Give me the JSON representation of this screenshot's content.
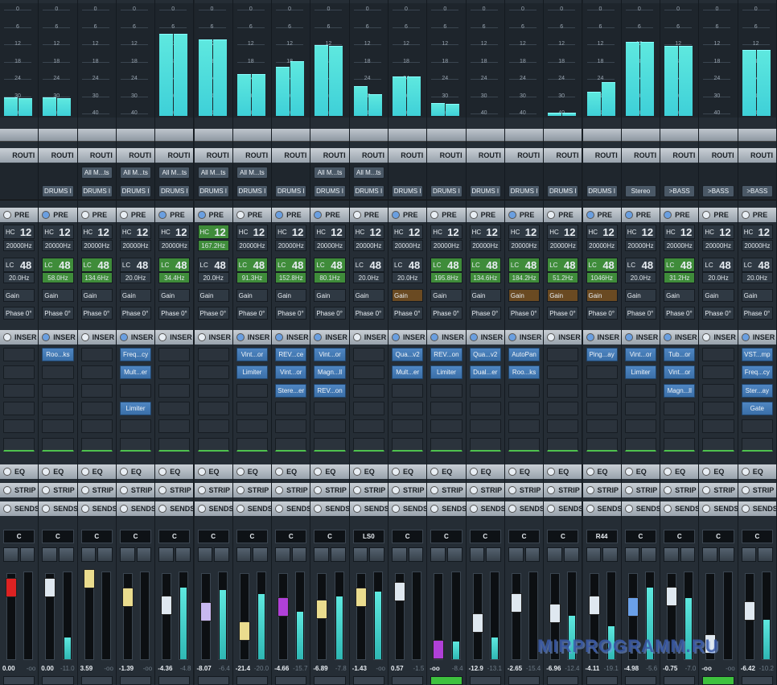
{
  "meter_scale": [
    "0",
    "6",
    "12",
    "18",
    "24",
    "30",
    "40"
  ],
  "section_labels": {
    "routing": "ROUTI",
    "pre": "PRE",
    "inserts": "INSER",
    "eq": "EQ",
    "strip": "STRIP",
    "sends": "SENDS"
  },
  "watermark": "MIRPROGRAMM.RU",
  "channels": [
    {
      "meter": [
        0.17,
        0.16
      ],
      "route_top": "",
      "route_bottom": "",
      "pre_on": false,
      "hc_freq": "20000Hz",
      "hc_hi": false,
      "lc_freq": "20.0Hz",
      "lc_hi": false,
      "gain_org": false,
      "inserts": [
        "",
        "",
        "",
        "",
        "",
        ""
      ],
      "pan": "C",
      "fader": 0.85,
      "fader_color": "#d22",
      "vu": 0,
      "val": "0.00",
      "peak": "-oo",
      "bottom_green": false
    },
    {
      "meter": [
        0.17,
        0.16
      ],
      "route_top": "",
      "route_bottom": "DRUMS I",
      "pre_on": true,
      "hc_freq": "20000Hz",
      "hc_hi": false,
      "lc_freq": "58.0Hz",
      "lc_hi": true,
      "gain_org": false,
      "inserts": [
        "Roo...ks",
        "",
        "",
        "",
        "",
        ""
      ],
      "pan": "C",
      "fader": 0.85,
      "fader_color": "#dfe8f0",
      "vu": 0.25,
      "val": "0.00",
      "peak": "-11.0",
      "bottom_green": false
    },
    {
      "meter": [
        0,
        0
      ],
      "route_top": "All M...ts",
      "route_bottom": "DRUMS I",
      "pre_on": false,
      "hc_freq": "20000Hz",
      "hc_hi": false,
      "lc_freq": "134.6Hz",
      "lc_hi": true,
      "gain_org": false,
      "inserts": [
        "",
        "",
        "",
        "",
        "",
        ""
      ],
      "pan": "C",
      "fader": 0.97,
      "fader_color": "#eadc8e",
      "vu": 0,
      "val": "3.59",
      "peak": "-oo",
      "bottom_green": false
    },
    {
      "meter": [
        0,
        0
      ],
      "route_top": "All M...ts",
      "route_bottom": "DRUMS I",
      "pre_on": false,
      "hc_freq": "20000Hz",
      "hc_hi": false,
      "lc_freq": "20.0Hz",
      "lc_hi": false,
      "gain_org": false,
      "inserts": [
        "Freq...cy",
        "Mult...er",
        "",
        "Limiter",
        "",
        ""
      ],
      "pan": "C",
      "fader": 0.73,
      "fader_color": "#eadc8e",
      "vu": 0,
      "val": "-1.39",
      "peak": "-oo",
      "bottom_green": false
    },
    {
      "meter": [
        0.75,
        0.75
      ],
      "route_top": "All M...ts",
      "route_bottom": "DRUMS I",
      "pre_on": true,
      "hc_freq": "20000Hz",
      "hc_hi": false,
      "lc_freq": "34.4Hz",
      "lc_hi": true,
      "gain_org": false,
      "inserts": [
        "",
        "",
        "",
        "",
        "",
        ""
      ],
      "pan": "C",
      "fader": 0.62,
      "fader_color": "#dfe8f0",
      "vu": 0.82,
      "val": "-4.36",
      "peak": "-4.8",
      "bottom_green": false
    },
    {
      "meter": [
        0.7,
        0.7
      ],
      "route_top": "All M...ts",
      "route_bottom": "DRUMS I",
      "pre_on": true,
      "hc_freq": "167.2Hz",
      "hc_hi": true,
      "lc_freq": "20.0Hz",
      "lc_hi": false,
      "gain_org": false,
      "inserts": [
        "",
        "",
        "",
        "",
        "",
        ""
      ],
      "pan": "C",
      "fader": 0.54,
      "fader_color": "#c8b8f0",
      "vu": 0.8,
      "val": "-8.07",
      "peak": "-6.4",
      "bottom_green": false
    },
    {
      "meter": [
        0.38,
        0.38
      ],
      "route_top": "All M...ts",
      "route_bottom": "DRUMS I",
      "pre_on": false,
      "hc_freq": "20000Hz",
      "hc_hi": false,
      "lc_freq": "91.3Hz",
      "lc_hi": true,
      "gain_org": false,
      "inserts": [
        "Vint...or",
        "Limiter",
        "",
        "",
        "",
        ""
      ],
      "pan": "C",
      "fader": 0.29,
      "fader_color": "#eadc8e",
      "vu": 0.75,
      "val": "-21.4",
      "peak": "-20.0",
      "bottom_green": false
    },
    {
      "meter": [
        0.45,
        0.5
      ],
      "route_top": "",
      "route_bottom": "DRUMS I",
      "pre_on": true,
      "hc_freq": "20000Hz",
      "hc_hi": false,
      "lc_freq": "152.8Hz",
      "lc_hi": true,
      "gain_org": false,
      "inserts": [
        "REV...ce",
        "Vint...or",
        "Stere...er",
        "",
        "",
        ""
      ],
      "pan": "C",
      "fader": 0.6,
      "fader_color": "#b040d8",
      "vu": 0.55,
      "val": "-4.66",
      "peak": "-15.7",
      "bottom_green": false
    },
    {
      "meter": [
        0.65,
        0.64
      ],
      "route_top": "All M...ts",
      "route_bottom": "DRUMS I",
      "pre_on": true,
      "hc_freq": "20000Hz",
      "hc_hi": false,
      "lc_freq": "80.1Hz",
      "lc_hi": true,
      "gain_org": false,
      "inserts": [
        "Vint...or",
        "Magn...ll",
        "REV...on",
        "",
        "",
        ""
      ],
      "pan": "C",
      "fader": 0.57,
      "fader_color": "#eadc8e",
      "vu": 0.72,
      "val": "-6.89",
      "peak": "-7.8",
      "bottom_green": false
    },
    {
      "meter": [
        0.27,
        0.2
      ],
      "route_top": "All M...ts",
      "route_bottom": "DRUMS I",
      "pre_on": false,
      "hc_freq": "20000Hz",
      "hc_hi": false,
      "lc_freq": "20.0Hz",
      "lc_hi": false,
      "gain_org": false,
      "inserts": [
        "",
        "",
        "",
        "",
        "",
        ""
      ],
      "pan": "LS0",
      "fader": 0.73,
      "fader_color": "#eadc8e",
      "vu": 0.78,
      "val": "-1.43",
      "peak": "-oo",
      "bottom_green": false
    },
    {
      "meter": [
        0.36,
        0.36
      ],
      "route_top": "",
      "route_bottom": "DRUMS I",
      "pre_on": true,
      "hc_freq": "20000Hz",
      "hc_hi": false,
      "lc_freq": "20.0Hz",
      "lc_hi": false,
      "gain_org": true,
      "inserts": [
        "Qua...v2",
        "Mult...er",
        "",
        "",
        "",
        ""
      ],
      "pan": "C",
      "fader": 0.8,
      "fader_color": "#dfe8f0",
      "vu": 0,
      "val": "0.57",
      "peak": "-1.5",
      "bottom_green": false
    },
    {
      "meter": [
        0.12,
        0.11
      ],
      "route_top": "",
      "route_bottom": "DRUMS I",
      "pre_on": false,
      "hc_freq": "20000Hz",
      "hc_hi": false,
      "lc_freq": "195.8Hz",
      "lc_hi": true,
      "gain_org": false,
      "inserts": [
        "REV...on",
        "Limiter",
        "",
        "",
        "",
        ""
      ],
      "pan": "C",
      "fader": 0.05,
      "fader_color": "#b040d8",
      "vu": 0.2,
      "val": "-oo",
      "peak": "-8.4",
      "bottom_green": true
    },
    {
      "meter": [
        0,
        0
      ],
      "route_top": "",
      "route_bottom": "DRUMS I",
      "pre_on": false,
      "hc_freq": "20000Hz",
      "hc_hi": false,
      "lc_freq": "134.6Hz",
      "lc_hi": true,
      "gain_org": false,
      "inserts": [
        "Qua...v2",
        "Dual...er",
        "",
        "",
        "",
        ""
      ],
      "pan": "C",
      "fader": 0.4,
      "fader_color": "#dfe8f0",
      "vu": 0.25,
      "val": "-12.9",
      "peak": "-13.1",
      "bottom_green": false
    },
    {
      "meter": [
        0,
        0
      ],
      "route_top": "",
      "route_bottom": "DRUMS I",
      "pre_on": true,
      "hc_freq": "20000Hz",
      "hc_hi": false,
      "lc_freq": "184.2Hz",
      "lc_hi": true,
      "gain_org": true,
      "inserts": [
        "AutoPan",
        "Roo...ks",
        "",
        "",
        "",
        ""
      ],
      "pan": "C",
      "fader": 0.66,
      "fader_color": "#dfe8f0",
      "vu": 0,
      "val": "-2.65",
      "peak": "-15.4",
      "bottom_green": false
    },
    {
      "meter": [
        0.03,
        0.03
      ],
      "route_top": "",
      "route_bottom": "DRUMS I",
      "pre_on": false,
      "hc_freq": "20000Hz",
      "hc_hi": false,
      "lc_freq": "51.2Hz",
      "lc_hi": true,
      "gain_org": true,
      "inserts": [
        "",
        "",
        "",
        "",
        "",
        ""
      ],
      "pan": "C",
      "fader": 0.52,
      "fader_color": "#dfe8f0",
      "vu": 0.5,
      "val": "-6.96",
      "peak": "-12.4",
      "bottom_green": false
    },
    {
      "meter": [
        0.22,
        0.31
      ],
      "route_top": "",
      "route_bottom": "DRUMS I",
      "pre_on": true,
      "hc_freq": "20000Hz",
      "hc_hi": false,
      "lc_freq": "1046Hz",
      "lc_hi": true,
      "gain_org": true,
      "inserts": [
        "Ping...ay",
        "",
        "",
        "",
        "",
        ""
      ],
      "pan": "R44",
      "fader": 0.63,
      "fader_color": "#dfe8f0",
      "vu": 0.38,
      "val": "-4.11",
      "peak": "-19.1",
      "bottom_green": false
    },
    {
      "meter": [
        0.68,
        0.68
      ],
      "route_top": "",
      "route_bottom": "Stereo",
      "pre_on": true,
      "hc_freq": "20000Hz",
      "hc_hi": false,
      "lc_freq": "20.0Hz",
      "lc_hi": false,
      "gain_org": false,
      "inserts": [
        "Vint...or",
        "Limiter",
        "",
        "",
        "",
        ""
      ],
      "pan": "C",
      "fader": 0.6,
      "fader_color": "#6aa0e8",
      "vu": 0.82,
      "val": "-4.98",
      "peak": "-5.6",
      "bottom_green": false
    },
    {
      "meter": [
        0.64,
        0.64
      ],
      "route_top": "",
      "route_bottom": ">BASS",
      "pre_on": true,
      "hc_freq": "20000Hz",
      "hc_hi": false,
      "lc_freq": "31.2Hz",
      "lc_hi": true,
      "gain_org": false,
      "inserts": [
        "Tub...or",
        "Vint...or",
        "Magn...ll",
        "",
        "",
        ""
      ],
      "pan": "C",
      "fader": 0.74,
      "fader_color": "#dfe8f0",
      "vu": 0.7,
      "val": "-0.75",
      "peak": "-7.0",
      "bottom_green": false
    },
    {
      "meter": [
        0,
        0
      ],
      "route_top": "",
      "route_bottom": ">BASS",
      "pre_on": false,
      "hc_freq": "20000Hz",
      "hc_hi": false,
      "lc_freq": "20.0Hz",
      "lc_hi": false,
      "gain_org": false,
      "inserts": [
        "",
        "",
        "",
        "",
        "",
        ""
      ],
      "pan": "C",
      "fader": 0.12,
      "fader_color": "#dfe8f0",
      "vu": 0,
      "val": "-oo",
      "peak": "-oo",
      "bottom_green": true
    },
    {
      "meter": [
        0.6,
        0.6
      ],
      "route_top": "",
      "route_bottom": ">BASS",
      "pre_on": false,
      "hc_freq": "20000Hz",
      "hc_hi": false,
      "lc_freq": "20.0Hz",
      "lc_hi": false,
      "gain_org": false,
      "inserts": [
        "VST...mp",
        "Freq...cy",
        "Ster...ay",
        "Gate",
        "",
        ""
      ],
      "pan": "C",
      "fader": 0.55,
      "fader_color": "#dfe8f0",
      "vu": 0.45,
      "val": "-6.42",
      "peak": "-10.2",
      "bottom_green": false
    }
  ]
}
